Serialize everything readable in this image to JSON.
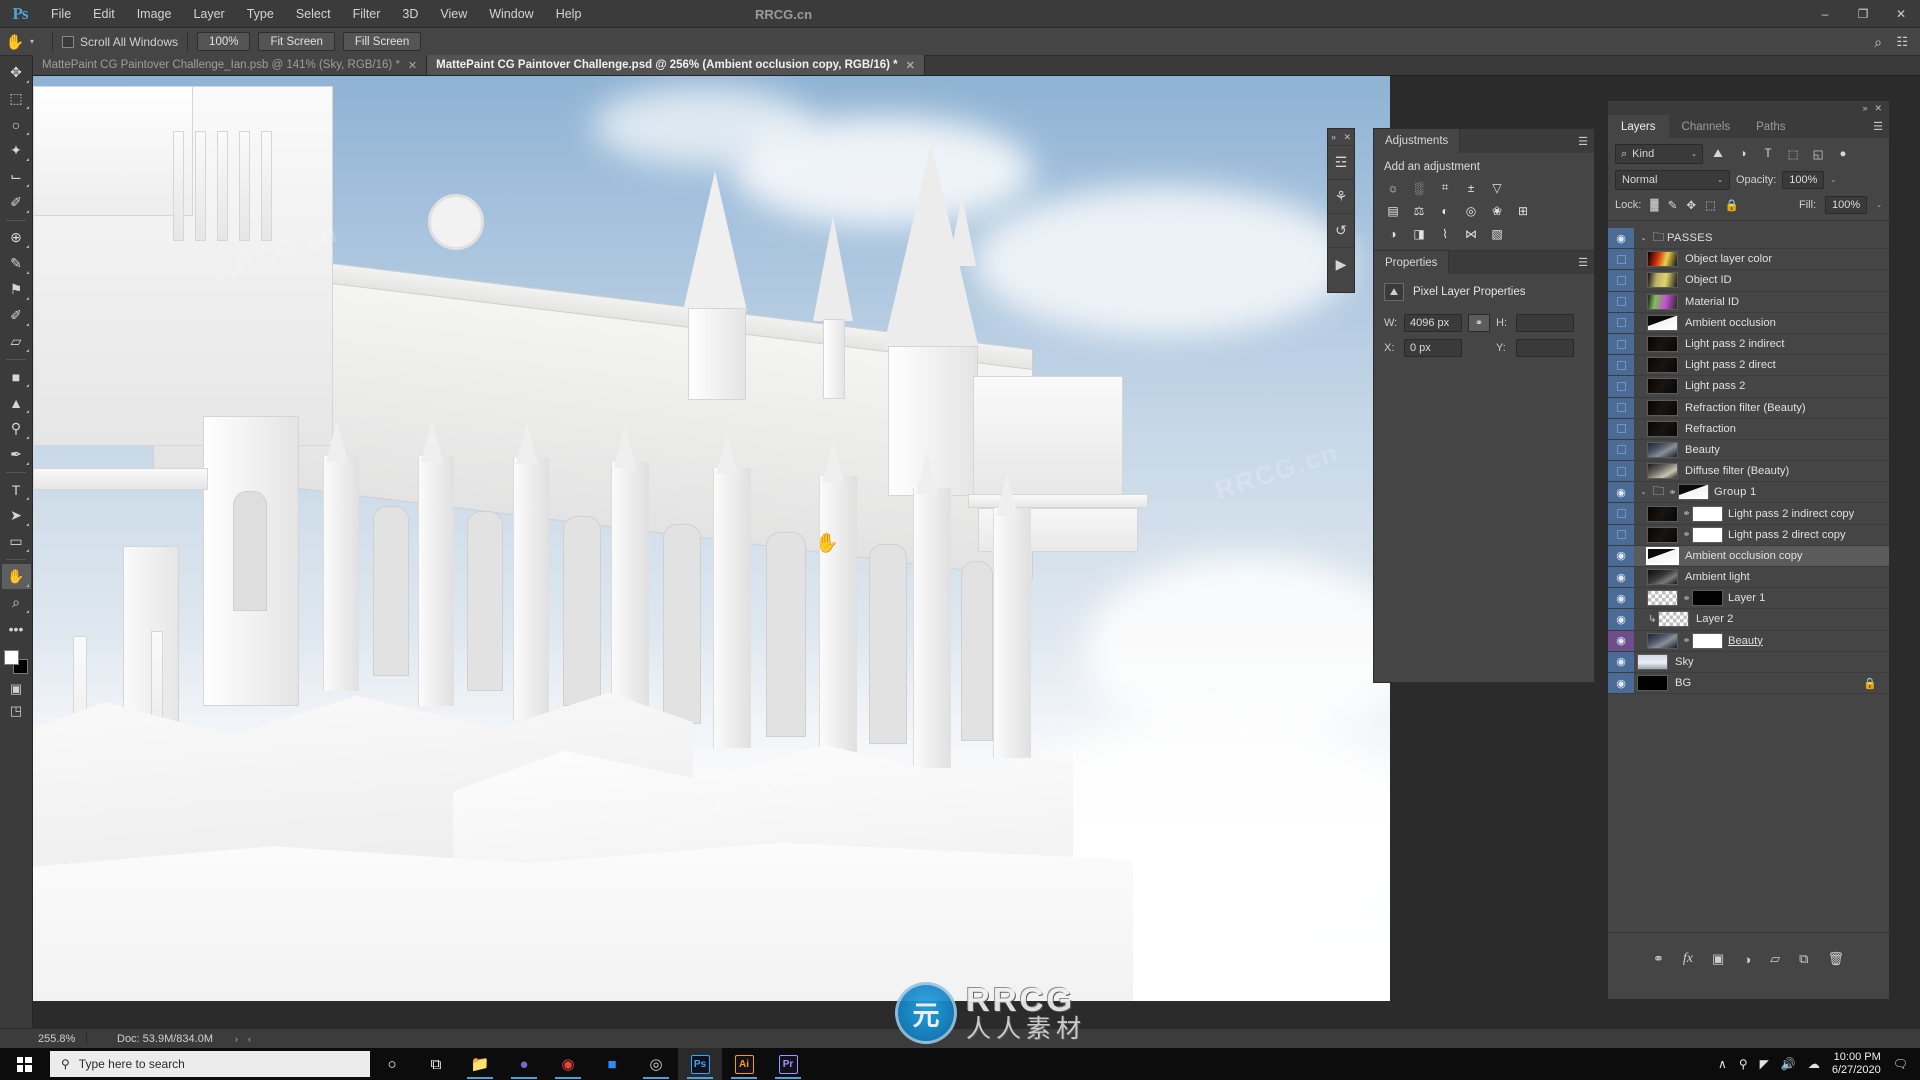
{
  "titlebar": {
    "logo": "Ps",
    "watermark_title": "RRCG.cn",
    "menus": [
      "File",
      "Edit",
      "Image",
      "Layer",
      "Type",
      "Select",
      "Filter",
      "3D",
      "View",
      "Window",
      "Help"
    ],
    "window_controls": [
      {
        "name": "minimize",
        "glyph": "–"
      },
      {
        "name": "maximize",
        "glyph": "❐"
      },
      {
        "name": "close",
        "glyph": "✕"
      }
    ]
  },
  "options_bar": {
    "tool_icon": "hand-icon",
    "tool_glyph": "✋",
    "caret": "▾",
    "scroll_all_windows_label": "Scroll All Windows",
    "scroll_all_windows_checked": false,
    "buttons": [
      "100%",
      "Fit Screen",
      "Fill Screen"
    ],
    "search_glyph": "⌕",
    "grid_glyph": "☷"
  },
  "document_tabs": [
    {
      "label": "MattePaint CG Paintover Challenge_Ian.psb @ 141% (Sky, RGB/16) *",
      "active": false,
      "close_glyph": "✕"
    },
    {
      "label": "MattePaint CG Paintover Challenge.psd @ 256% (Ambient occlusion copy, RGB/16) *",
      "active": true,
      "close_glyph": "✕"
    }
  ],
  "toolbar": {
    "tools": [
      {
        "name": "move-tool",
        "glyph": "✥",
        "active": false
      },
      {
        "name": "rectangular-marquee-tool",
        "glyph": "⬚",
        "active": false
      },
      {
        "name": "lasso-tool",
        "glyph": "○",
        "active": false
      },
      {
        "name": "quick-selection-tool",
        "glyph": "✦",
        "active": false
      },
      {
        "name": "crop-tool",
        "glyph": "⌙",
        "active": false
      },
      {
        "name": "eyedropper-tool",
        "glyph": "✐",
        "active": false
      },
      {
        "name": "spot-healing-brush-tool",
        "glyph": "⊕",
        "active": false
      },
      {
        "name": "brush-tool",
        "glyph": "✎",
        "active": false
      },
      {
        "name": "clone-stamp-tool",
        "glyph": "⚑",
        "active": false
      },
      {
        "name": "history-brush-tool",
        "glyph": "✐",
        "active": false
      },
      {
        "name": "eraser-tool",
        "glyph": "▱",
        "active": false
      },
      {
        "name": "gradient-tool",
        "glyph": "■",
        "active": false
      },
      {
        "name": "blur-tool",
        "glyph": "▲",
        "active": false
      },
      {
        "name": "dodge-tool",
        "glyph": "⚲",
        "active": false
      },
      {
        "name": "pen-tool",
        "glyph": "✒",
        "active": false
      },
      {
        "name": "type-tool",
        "glyph": "T",
        "active": false
      },
      {
        "name": "path-selection-tool",
        "glyph": "➤",
        "active": false
      },
      {
        "name": "rectangle-tool",
        "glyph": "▭",
        "active": false
      },
      {
        "name": "hand-tool",
        "glyph": "✋",
        "active": true
      },
      {
        "name": "zoom-tool",
        "glyph": "⌕",
        "active": false
      },
      {
        "name": "more-tools",
        "glyph": "•••",
        "active": false
      }
    ],
    "foreground_color": "#ffffff",
    "background_color": "#000000",
    "quick_mask_glyph": "▣",
    "screen_mode_glyph": "◳"
  },
  "canvas": {
    "hand_cursor_glyph": "✋",
    "watermarks": [
      "RRCG.cn",
      "RRCG.cn",
      "RRCG.cn"
    ]
  },
  "minidock": {
    "collapse_glyph": "»",
    "close_glyph": "✕",
    "icons": [
      {
        "name": "adjustments-dock-icon",
        "glyph": "☲"
      },
      {
        "name": "brushes-dock-icon",
        "glyph": "⚘"
      },
      {
        "name": "history-dock-icon",
        "glyph": "↺"
      },
      {
        "name": "actions-dock-icon",
        "glyph": "▶"
      }
    ]
  },
  "adjustments_panel": {
    "tabs": [
      {
        "label": "Adjustments",
        "active": true
      }
    ],
    "burger_glyph": "☰",
    "heading": "Add an adjustment",
    "icons_row1": [
      {
        "name": "brightness-contrast-icon",
        "glyph": "☼"
      },
      {
        "name": "levels-icon",
        "glyph": "░"
      },
      {
        "name": "curves-icon",
        "glyph": "⌗"
      },
      {
        "name": "exposure-icon",
        "glyph": "±"
      },
      {
        "name": "vibrance-icon",
        "glyph": "▽"
      }
    ],
    "icons_row2": [
      {
        "name": "hue-saturation-icon",
        "glyph": "▤"
      },
      {
        "name": "color-balance-icon",
        "glyph": "⚖"
      },
      {
        "name": "black-white-icon",
        "glyph": "◐"
      },
      {
        "name": "photo-filter-icon",
        "glyph": "◎"
      },
      {
        "name": "channel-mixer-icon",
        "glyph": "❀"
      },
      {
        "name": "color-lookup-icon",
        "glyph": "⊞"
      }
    ],
    "icons_row3": [
      {
        "name": "invert-icon",
        "glyph": "◑"
      },
      {
        "name": "posterize-icon",
        "glyph": "◨"
      },
      {
        "name": "threshold-icon",
        "glyph": "⌇"
      },
      {
        "name": "selective-color-icon",
        "glyph": "⋈"
      },
      {
        "name": "gradient-map-icon",
        "glyph": "▧"
      }
    ]
  },
  "properties_panel": {
    "tab_label": "Properties",
    "burger_glyph": "☰",
    "type_icon": "pixel-layer-icon",
    "type_glyph": "⛰",
    "type_label": "Pixel Layer Properties",
    "fields": {
      "w_label": "W:",
      "w_value": "4096 px",
      "h_label": "H:",
      "h_value": "",
      "x_label": "X:",
      "x_value": "0 px",
      "y_label": "Y:",
      "y_value": "",
      "link_glyph": "⚭"
    }
  },
  "layers_panel": {
    "collapse_glyph": "»",
    "close_glyph": "✕",
    "tabs": [
      {
        "label": "Layers",
        "active": true
      },
      {
        "label": "Channels",
        "active": false
      },
      {
        "label": "Paths",
        "active": false
      }
    ],
    "burger_glyph": "☰",
    "filter": {
      "search_glyph": "⌕",
      "kind_label": "Kind",
      "caret_glyph": "⌄",
      "icons": [
        {
          "name": "filter-pixel-icon",
          "glyph": "⛰"
        },
        {
          "name": "filter-adjustment-icon",
          "glyph": "◑"
        },
        {
          "name": "filter-type-icon",
          "glyph": "T"
        },
        {
          "name": "filter-shape-icon",
          "glyph": "⬚"
        },
        {
          "name": "filter-smart-object-icon",
          "glyph": "◱"
        },
        {
          "name": "filter-toggle-icon",
          "glyph": "●"
        }
      ]
    },
    "blend": {
      "mode": "Normal",
      "caret_glyph": "⌄",
      "opacity_label": "Opacity:",
      "opacity_value": "100%",
      "fill_label": "Fill:",
      "fill_value": "100%",
      "tiny_caret": "⌄"
    },
    "lock": {
      "label": "Lock:",
      "icons": [
        {
          "name": "lock-transparent-pixels-icon",
          "glyph": "▓"
        },
        {
          "name": "lock-image-pixels-icon",
          "glyph": "✎"
        },
        {
          "name": "lock-position-icon",
          "glyph": "✥"
        },
        {
          "name": "lock-artboard-nesting-icon",
          "glyph": "⬚"
        },
        {
          "name": "lock-all-icon",
          "glyph": "🔒"
        }
      ]
    },
    "layers": [
      {
        "name": "PASSES",
        "visible": true,
        "type": "group",
        "indent": 0,
        "expanded": true,
        "selected": false,
        "thumb": "folder",
        "has_mask": false,
        "clipped": false,
        "locked": false
      },
      {
        "name": "Object layer color",
        "visible": false,
        "type": "layer",
        "indent": 1,
        "selected": false,
        "thumb": "color-pass",
        "has_mask": false,
        "clipped": false,
        "locked": false
      },
      {
        "name": "Object ID",
        "visible": false,
        "type": "layer",
        "indent": 1,
        "selected": false,
        "thumb": "objectid-pass",
        "has_mask": false,
        "clipped": false,
        "locked": false
      },
      {
        "name": "Material ID",
        "visible": false,
        "type": "layer",
        "indent": 1,
        "selected": false,
        "thumb": "materialid-pass",
        "has_mask": false,
        "clipped": false,
        "locked": false
      },
      {
        "name": "Ambient occlusion",
        "visible": false,
        "type": "layer",
        "indent": 1,
        "selected": false,
        "thumb": "ao-pass",
        "has_mask": false,
        "clipped": false,
        "locked": false
      },
      {
        "name": "Light pass 2 indirect",
        "visible": false,
        "type": "layer",
        "indent": 1,
        "selected": false,
        "thumb": "dark-pass",
        "has_mask": false,
        "clipped": false,
        "locked": false
      },
      {
        "name": "Light pass 2 direct",
        "visible": false,
        "type": "layer",
        "indent": 1,
        "selected": false,
        "thumb": "dark-pass",
        "has_mask": false,
        "clipped": false,
        "locked": false
      },
      {
        "name": "Light pass 2",
        "visible": false,
        "type": "layer",
        "indent": 1,
        "selected": false,
        "thumb": "dark-pass",
        "has_mask": false,
        "clipped": false,
        "locked": false
      },
      {
        "name": "Refraction filter (Beauty)",
        "visible": false,
        "type": "layer",
        "indent": 1,
        "selected": false,
        "thumb": "dark-pass",
        "has_mask": false,
        "clipped": false,
        "locked": false
      },
      {
        "name": "Refraction",
        "visible": false,
        "type": "layer",
        "indent": 1,
        "selected": false,
        "thumb": "dark-pass",
        "has_mask": false,
        "clipped": false,
        "locked": false
      },
      {
        "name": "Beauty",
        "visible": false,
        "type": "layer",
        "indent": 1,
        "selected": false,
        "thumb": "beauty-pass",
        "has_mask": false,
        "clipped": false,
        "locked": false
      },
      {
        "name": "Diffuse filter (Beauty)",
        "visible": false,
        "type": "layer",
        "indent": 1,
        "selected": false,
        "thumb": "diffuse-pass",
        "has_mask": false,
        "clipped": false,
        "locked": false
      },
      {
        "name": "Group 1",
        "visible": true,
        "type": "group",
        "indent": 0,
        "expanded": true,
        "selected": false,
        "thumb": "folder",
        "has_mask": true,
        "mask": "ao-mask",
        "clipped": false,
        "locked": false
      },
      {
        "name": "Light pass 2 indirect copy",
        "visible": false,
        "type": "layer",
        "indent": 1,
        "selected": false,
        "thumb": "dark-pass",
        "has_mask": true,
        "mask": "white-mask",
        "clipped": false,
        "locked": false
      },
      {
        "name": "Light pass 2 direct copy",
        "visible": false,
        "type": "layer",
        "indent": 1,
        "selected": false,
        "thumb": "dark-pass",
        "has_mask": true,
        "mask": "white-mask",
        "clipped": false,
        "locked": false
      },
      {
        "name": "Ambient occlusion copy",
        "visible": true,
        "type": "layer",
        "indent": 1,
        "selected": true,
        "thumb": "ao-pass",
        "has_mask": false,
        "clipped": false,
        "locked": false
      },
      {
        "name": "Ambient light",
        "visible": true,
        "type": "layer",
        "indent": 1,
        "selected": false,
        "thumb": "ambient-pass",
        "has_mask": false,
        "clipped": false,
        "locked": false
      },
      {
        "name": "Layer 1",
        "visible": true,
        "type": "layer",
        "indent": 1,
        "selected": false,
        "thumb": "transparent",
        "has_mask": true,
        "mask": "black-mask",
        "clipped": false,
        "locked": false
      },
      {
        "name": "Layer 2",
        "visible": true,
        "type": "layer",
        "indent": 1,
        "selected": false,
        "thumb": "transparent",
        "has_mask": false,
        "clipped": true,
        "locked": false
      },
      {
        "name": "Beauty ",
        "visible": true,
        "type": "layer",
        "indent": 1,
        "selected": false,
        "thumb": "beauty-pass",
        "has_mask": true,
        "mask": "white-mask",
        "clipped": false,
        "locked": false,
        "underline": true,
        "eye_color": "purple"
      },
      {
        "name": "Sky",
        "visible": true,
        "type": "layer",
        "indent": 0,
        "selected": false,
        "thumb": "sky-pass",
        "has_mask": false,
        "clipped": false,
        "locked": false
      },
      {
        "name": "BG",
        "visible": true,
        "type": "layer",
        "indent": 0,
        "selected": false,
        "thumb": "black-pass",
        "has_mask": false,
        "clipped": false,
        "locked": true
      }
    ],
    "footer_buttons": [
      {
        "name": "link-layers-button",
        "glyph": "⚭"
      },
      {
        "name": "layer-style-button",
        "glyph": "fx"
      },
      {
        "name": "add-layer-mask-button",
        "glyph": "▣"
      },
      {
        "name": "new-adjustment-layer-button",
        "glyph": "◑"
      },
      {
        "name": "new-group-button",
        "glyph": "▱"
      },
      {
        "name": "new-layer-button",
        "glyph": "⧉"
      },
      {
        "name": "delete-layer-button",
        "glyph": "🗑"
      }
    ]
  },
  "status_bar": {
    "zoom": "255.8%",
    "doc_info": "Doc: 53.9M/834.0M",
    "arrow_right": "›",
    "arrow_left": "‹"
  },
  "taskbar": {
    "search_placeholder": "Type here to search",
    "search_icon": "search-icon",
    "icons": [
      {
        "name": "cortana-icon",
        "glyph": "○",
        "open": false,
        "active": false,
        "color": "#ffffff"
      },
      {
        "name": "task-view-icon",
        "glyph": "⧉",
        "open": false,
        "active": false,
        "color": "#ffffff"
      },
      {
        "name": "file-explorer-icon",
        "glyph": "📁",
        "open": true,
        "active": false,
        "color": "#e8b64c"
      },
      {
        "name": "discord-icon",
        "glyph": "●",
        "open": true,
        "active": false,
        "color": "#7b68c9"
      },
      {
        "name": "chrome-icon",
        "glyph": "◉",
        "open": true,
        "active": false,
        "color": "#e8433b"
      },
      {
        "name": "zoom-meetings-icon",
        "glyph": "■",
        "open": false,
        "active": false,
        "color": "#2d8cff"
      },
      {
        "name": "obs-studio-icon",
        "glyph": "◎",
        "open": true,
        "active": false,
        "color": "#d0d0d0"
      },
      {
        "name": "photoshop-icon",
        "glyph": "Ps",
        "open": true,
        "active": true,
        "color": "#31a8ff"
      },
      {
        "name": "illustrator-icon",
        "glyph": "Ai",
        "open": true,
        "active": false,
        "color": "#ff9a00"
      },
      {
        "name": "premiere-icon",
        "glyph": "Pr",
        "open": true,
        "active": false,
        "color": "#9999ff"
      }
    ],
    "tray": [
      {
        "name": "show-hidden-icons",
        "glyph": "∧"
      },
      {
        "name": "microphone-icon",
        "glyph": "⚲"
      },
      {
        "name": "network-icon",
        "glyph": "◤"
      },
      {
        "name": "volume-icon",
        "glyph": "🔊"
      },
      {
        "name": "onedrive-icon",
        "glyph": "☁"
      }
    ],
    "clock_time": "10:00 PM",
    "clock_date": "6/27/2020",
    "action_center_glyph": "🗨"
  },
  "watermark": {
    "badge_glyph": "元",
    "brand": "RRCG",
    "subtitle": "人人素材"
  },
  "colors": {
    "accent_blue": "#4a6b96",
    "accent_purple": "#6d4d8a",
    "panel_bg": "#454545",
    "titlebar_bg": "#3b3b3b",
    "canvas_bg": "#2b2b2b"
  }
}
